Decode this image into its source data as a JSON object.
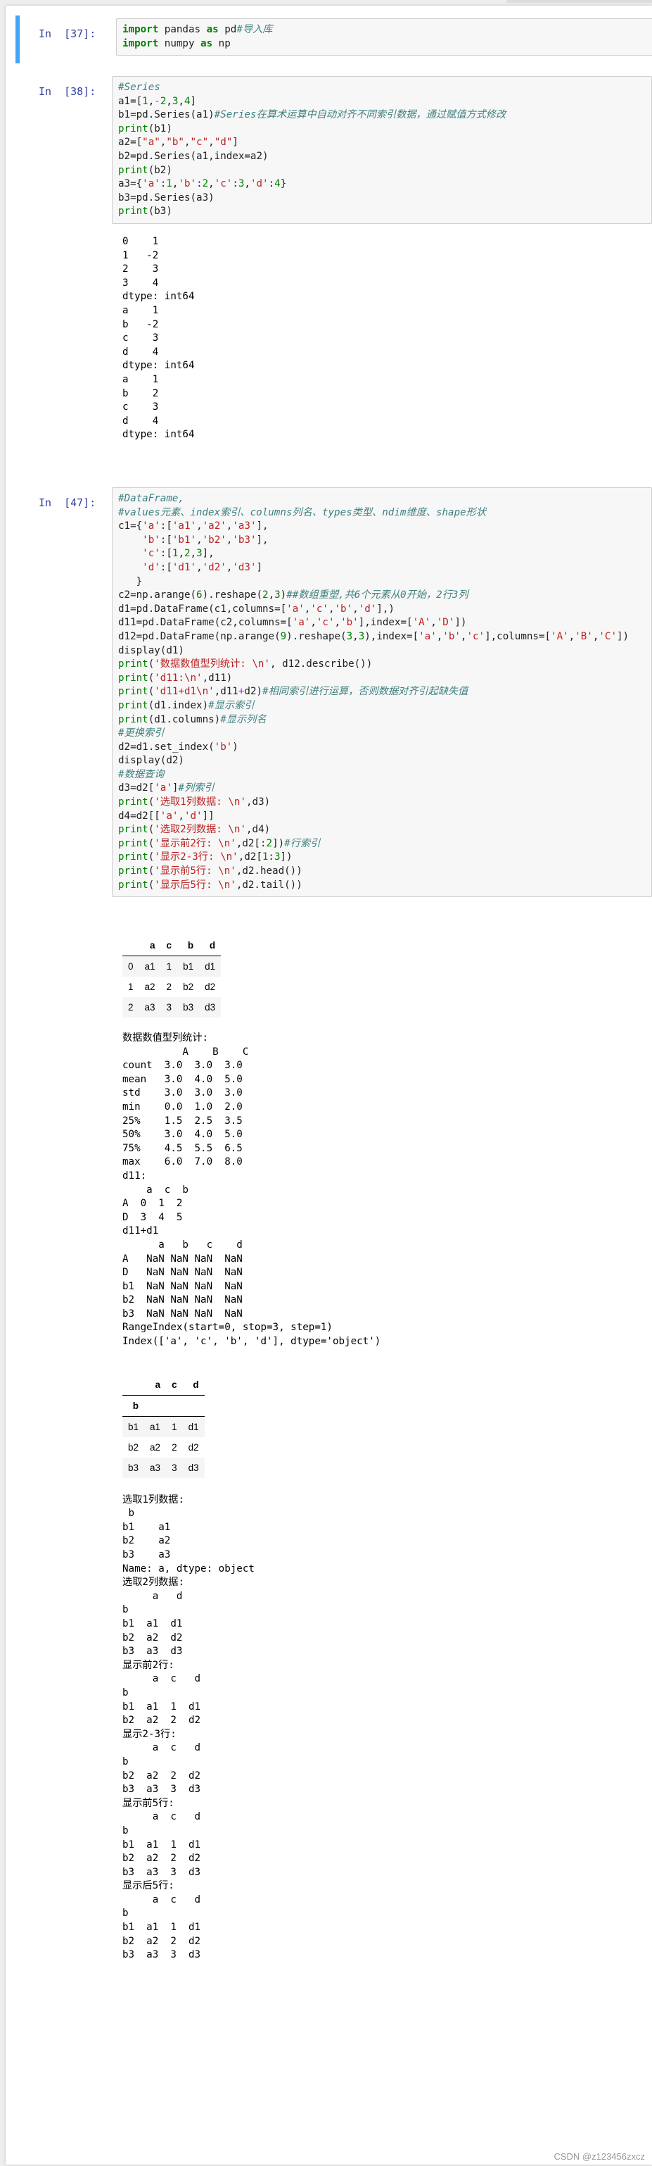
{
  "cells": [
    {
      "prompt": "In  [37]:"
    },
    {
      "prompt": "In  [38]:",
      "output": "0    1\n1   -2\n2    3\n3    4\ndtype: int64\na    1\nb   -2\nc    3\nd    4\ndtype: int64\na    1\nb    2\nc    3\nd    4\ndtype: int64"
    },
    {
      "prompt": "In  [47]:",
      "output_text1": "数据数值型列统计:\n          A    B    C\ncount  3.0  3.0  3.0\nmean   3.0  4.0  5.0\nstd    3.0  3.0  3.0\nmin    0.0  1.0  2.0\n25%    1.5  2.5  3.5\n50%    3.0  4.0  5.0\n75%    4.5  5.5  6.5\nmax    6.0  7.0  8.0\nd11:\n    a  c  b\nA  0  1  2\nD  3  4  5\nd11+d1\n      a   b   c    d\nA   NaN NaN NaN  NaN\nD   NaN NaN NaN  NaN\nb1  NaN NaN NaN  NaN\nb2  NaN NaN NaN  NaN\nb3  NaN NaN NaN  NaN\nRangeIndex(start=0, stop=3, step=1)\nIndex(['a', 'c', 'b', 'd'], dtype='object')",
      "output_text2": "选取1列数据:\n b\nb1    a1\nb2    a2\nb3    a3\nName: a, dtype: object\n选取2列数据:\n     a   d\nb\nb1  a1  d1\nb2  a2  d2\nb3  a3  d3\n显示前2行:\n     a  c   d\nb\nb1  a1  1  d1\nb2  a2  2  d2\n显示2-3行:\n     a  c   d\nb\nb2  a2  2  d2\nb3  a3  3  d3\n显示前5行:\n     a  c   d\nb\nb1  a1  1  d1\nb2  a2  2  d2\nb3  a3  3  d3\n显示后5行:\n     a  c   d\nb\nb1  a1  1  d1\nb2  a2  2  d2\nb3  a3  3  d3"
    }
  ],
  "table1": {
    "headers": [
      "",
      "a",
      "c",
      "b",
      "d"
    ],
    "rows": [
      [
        "0",
        "a1",
        "1",
        "b1",
        "d1"
      ],
      [
        "1",
        "a2",
        "2",
        "b2",
        "d2"
      ],
      [
        "2",
        "a3",
        "3",
        "b3",
        "d3"
      ]
    ]
  },
  "table2": {
    "headers": [
      "",
      "a",
      "c",
      "d"
    ],
    "index_name": "b",
    "rows": [
      [
        "b1",
        "a1",
        "1",
        "d1"
      ],
      [
        "b2",
        "a2",
        "2",
        "d2"
      ],
      [
        "b3",
        "a3",
        "3",
        "d3"
      ]
    ]
  },
  "watermark": "CSDN @z123456zxcz"
}
